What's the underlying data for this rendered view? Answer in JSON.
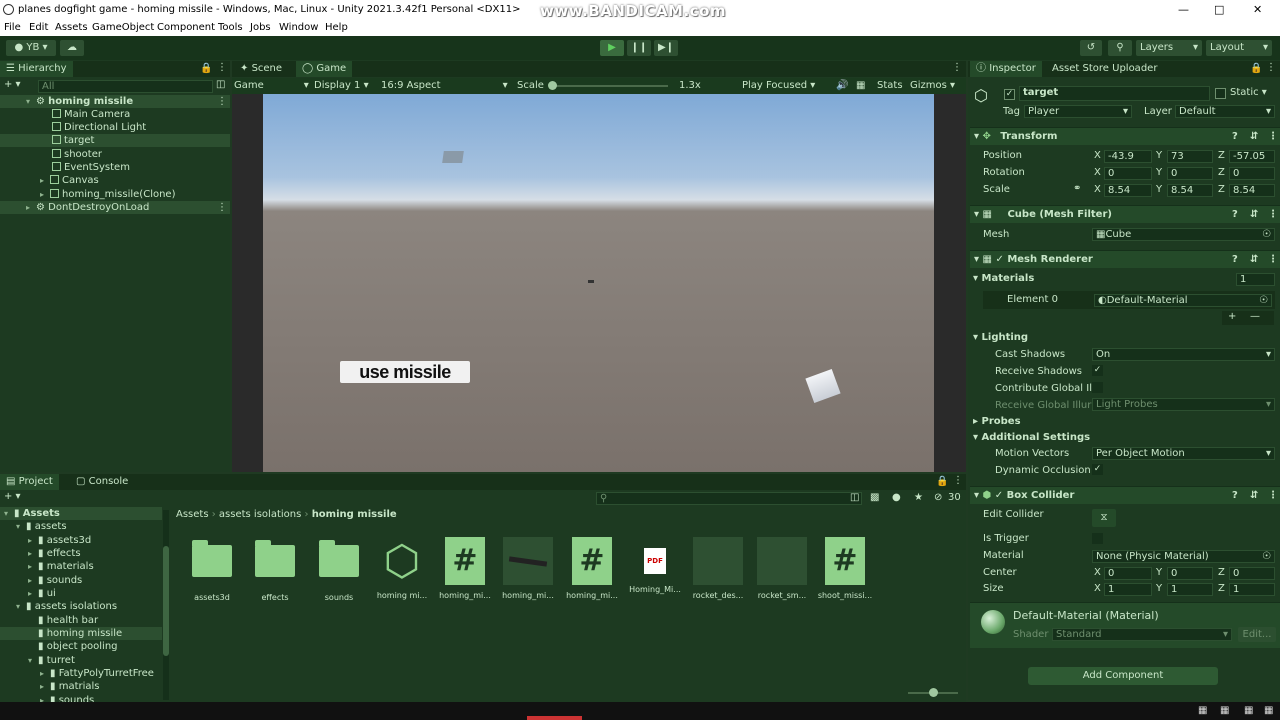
{
  "window": {
    "title": "planes dogfight game - homing missile - Windows, Mac, Linux - Unity 2021.3.42f1 Personal <DX11>",
    "watermark": "www.BANDICAM.com"
  },
  "menu": [
    "File",
    "Edit",
    "Assets",
    "GameObject",
    "Component",
    "Tools",
    "Jobs",
    "Window",
    "Help"
  ],
  "toolbar": {
    "account": "YB",
    "layers": "Layers",
    "layout": "Layout"
  },
  "hierarchy": {
    "tab": "Hierarchy",
    "search_placeholder": "All",
    "items": [
      {
        "label": "homing missile"
      },
      {
        "label": "Main Camera"
      },
      {
        "label": "Directional Light"
      },
      {
        "label": "target"
      },
      {
        "label": "shooter"
      },
      {
        "label": "EventSystem"
      },
      {
        "label": "Canvas"
      },
      {
        "label": "homing_missile(Clone)"
      },
      {
        "label": "DontDestroyOnLoad"
      }
    ]
  },
  "game": {
    "tabs": [
      "Scene",
      "Game"
    ],
    "display_mode": "Game",
    "display": "Display 1",
    "aspect": "16:9 Aspect",
    "scale_label": "Scale",
    "scale_value": "1.3x",
    "play_mode": "Play Focused",
    "stats": "Stats",
    "gizmos": "Gizmos",
    "button_label": "use missile"
  },
  "inspector": {
    "tabs": [
      "Inspector",
      "Asset Store Uploader"
    ],
    "object_name": "target",
    "static_label": "Static",
    "tag_label": "Tag",
    "tag_value": "Player",
    "layer_label": "Layer",
    "layer_value": "Default",
    "transform": {
      "title": "Transform",
      "position": {
        "label": "Position",
        "x": "-43.9",
        "y": "73",
        "z": "-57.05"
      },
      "rotation": {
        "label": "Rotation",
        "x": "0",
        "y": "0",
        "z": "0"
      },
      "scale": {
        "label": "Scale",
        "x": "8.54",
        "y": "8.54",
        "z": "8.54"
      }
    },
    "mesh_filter": {
      "title": "Cube (Mesh Filter)",
      "mesh_label": "Mesh",
      "mesh_value": "Cube"
    },
    "mesh_renderer": {
      "title": "Mesh Renderer",
      "materials_label": "Materials",
      "materials_count": "1",
      "element0_label": "Element 0",
      "element0_value": "Default-Material",
      "lighting": "Lighting",
      "cast_shadows_label": "Cast Shadows",
      "cast_shadows_value": "On",
      "receive_shadows_label": "Receive Shadows",
      "contribute_label": "Contribute Global Ill",
      "receive_gi_label": "Receive Global Illur",
      "receive_gi_value": "Light Probes",
      "probes": "Probes",
      "additional": "Additional Settings",
      "motion_label": "Motion Vectors",
      "motion_value": "Per Object Motion",
      "dynamic_label": "Dynamic Occlusion"
    },
    "box_collider": {
      "title": "Box Collider",
      "edit_label": "Edit Collider",
      "trigger_label": "Is Trigger",
      "material_label": "Material",
      "material_value": "None (Physic Material)",
      "center": {
        "label": "Center",
        "x": "0",
        "y": "0",
        "z": "0"
      },
      "size": {
        "label": "Size",
        "x": "1",
        "y": "1",
        "z": "1"
      }
    },
    "material": {
      "title": "Default-Material (Material)",
      "shader_label": "Shader",
      "shader_value": "Standard",
      "edit": "Edit..."
    },
    "add_component": "Add Component"
  },
  "project": {
    "tabs": [
      "Project",
      "Console"
    ],
    "count": "30",
    "breadcrumb": [
      "Assets",
      "assets isolations",
      "homing missile"
    ],
    "tree": [
      {
        "label": "Assets",
        "depth": 0,
        "bold": true
      },
      {
        "label": "assets",
        "depth": 1
      },
      {
        "label": "assets3d",
        "depth": 2
      },
      {
        "label": "effects",
        "depth": 2
      },
      {
        "label": "materials",
        "depth": 2
      },
      {
        "label": "sounds",
        "depth": 2
      },
      {
        "label": "ui",
        "depth": 2
      },
      {
        "label": "assets isolations",
        "depth": 1
      },
      {
        "label": "health bar",
        "depth": 2
      },
      {
        "label": "homing missile",
        "depth": 2
      },
      {
        "label": "object pooling",
        "depth": 2
      },
      {
        "label": "turret",
        "depth": 2
      },
      {
        "label": "FattyPolyTurretFree",
        "depth": 3
      },
      {
        "label": "matrials",
        "depth": 3
      },
      {
        "label": "sounds",
        "depth": 3
      }
    ],
    "assets": [
      {
        "label": "assets3d",
        "kind": "folder"
      },
      {
        "label": "effects",
        "kind": "folder"
      },
      {
        "label": "sounds",
        "kind": "folder"
      },
      {
        "label": "homing mi...",
        "kind": "unity"
      },
      {
        "label": "homing_mi...",
        "kind": "script"
      },
      {
        "label": "homing_mi...",
        "kind": "model"
      },
      {
        "label": "homing_mi...",
        "kind": "script"
      },
      {
        "label": "Homing_Mi...",
        "kind": "pdf"
      },
      {
        "label": "rocket_des...",
        "kind": "prefab"
      },
      {
        "label": "rocket_sm...",
        "kind": "prefab"
      },
      {
        "label": "shoot_missi...",
        "kind": "script"
      }
    ]
  }
}
